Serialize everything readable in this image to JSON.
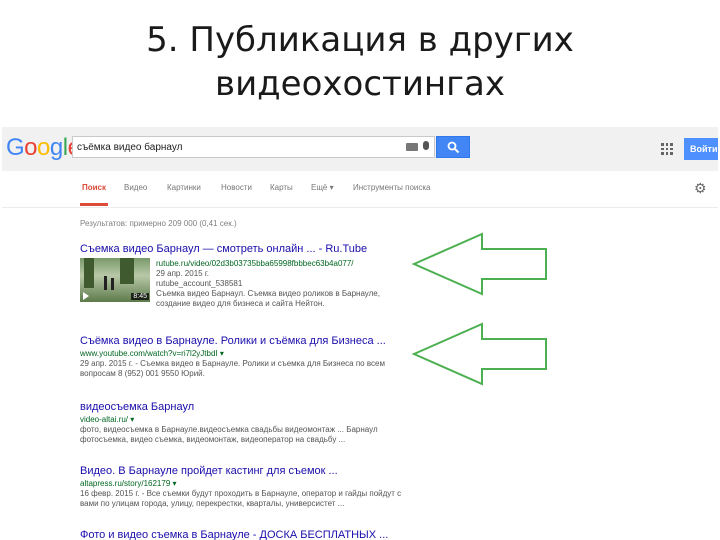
{
  "slide": {
    "title_line1": "5. Публикация в других",
    "title_line2": "видеохостингах"
  },
  "google": {
    "logo_letters": [
      {
        "ch": "G",
        "color": "#4285f4"
      },
      {
        "ch": "o",
        "color": "#ea4335"
      },
      {
        "ch": "o",
        "color": "#fbbc05"
      },
      {
        "ch": "g",
        "color": "#4285f4"
      },
      {
        "ch": "l",
        "color": "#34a853"
      },
      {
        "ch": "e",
        "color": "#ea4335"
      }
    ],
    "search_value": "съёмка видео барнаул",
    "signin_label": "Войти",
    "tabs": [
      "Поиск",
      "Видео",
      "Картинки",
      "Новости",
      "Карты",
      "Ещё ▾",
      "Инструменты поиска"
    ],
    "stats": "Результатов: примерно 209 000 (0,41 сек.)",
    "results": [
      {
        "title": "Съемка видео Барнаул — смотреть онлайн ... - Ru.Tube",
        "url": "rutube.ru/video/02d3b03735bba65998fbbbec63b4a077/",
        "date": "29 апр. 2015 г.",
        "author": "rutube_account_538581",
        "snippet": "Съемка видео Барнаул. Съемка видео роликов в Барнауле, создание видео для бизнеса и сайта Нейтон.",
        "duration": "8:45"
      },
      {
        "title": "Съёмка видео в Барнауле. Ролики и съёмка для Бизнеса ...",
        "url": "www.youtube.com/watch?v=ri7l2yJtbdI ▾",
        "snippet": "29 апр. 2015 г. - Съемка видео в Барнауле. Ролики и съемка для Бизнеса по всем вопросам 8 (952) 001 9550 Юрий."
      },
      {
        "title": "видеосъемка Барнаул",
        "url": "video-altai.ru/ ▾",
        "snippet": "фото, видеосъемка в Барнауле.видеосъемка свадьбы видеомонтаж ... Барнаул фотосъемка, видео съемка, видеомонтаж, видеоператор на свадьбу ..."
      },
      {
        "title": "Видео. В Барнауле пройдет кастинг для съемок ...",
        "url": "altapress.ru/story/162179 ▾",
        "snippet": "16 февр. 2015 г. - Все съемки будут проходить в Барнауле, оператор и гайды пойдут с вами по улицам города, улицу, перекрестки, кварталы, универсистет ..."
      },
      {
        "title": "Фото и видео съемка в Барнауле - ДОСКА БЕСПЛАТНЫХ ..."
      }
    ]
  },
  "colors": {
    "arrow": "#4caf50",
    "link": "#1a0dab",
    "url": "#006621",
    "active_tab": "#dd4b39"
  }
}
